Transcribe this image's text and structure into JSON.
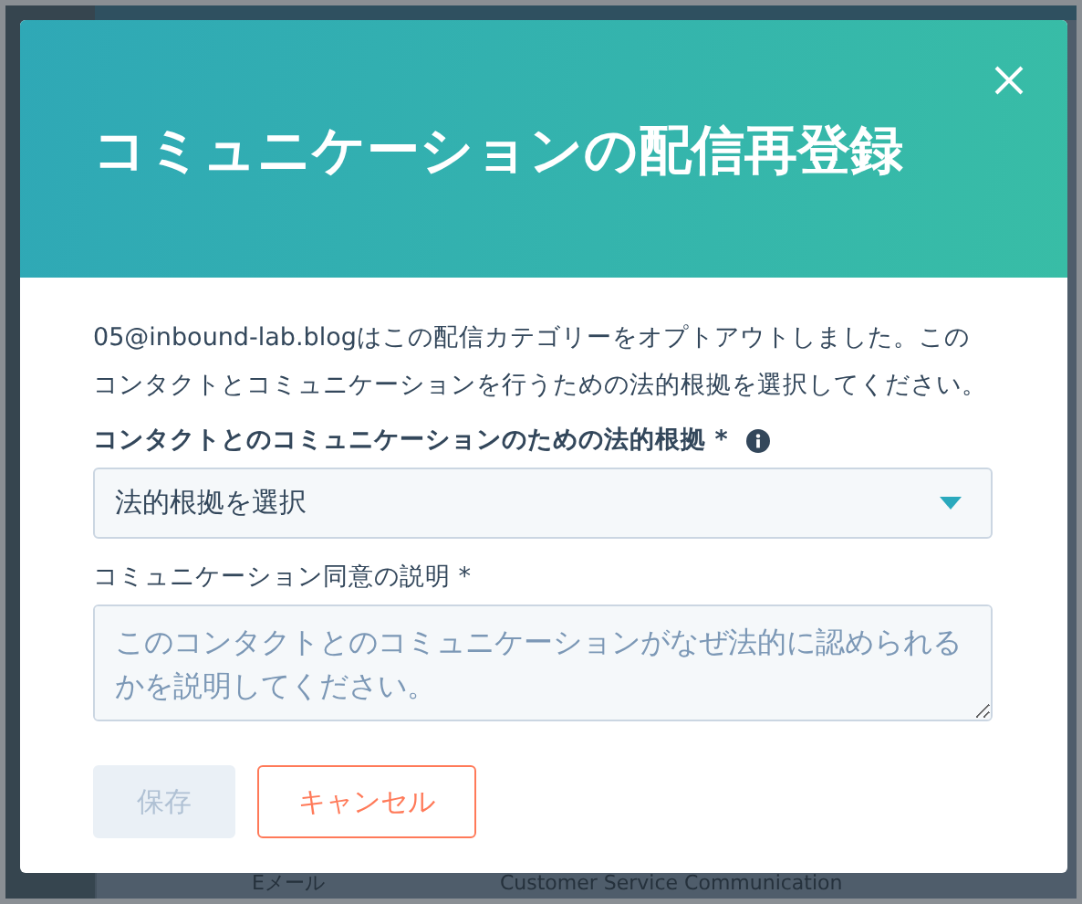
{
  "background": {
    "row": [
      "Eメール",
      "Customer Service Communication"
    ]
  },
  "dialog": {
    "title": "コミュニケーションの配信再登録",
    "message": "05@inbound-lab.blogはこの配信カテゴリーをオプトアウトしました。このコンタクトとコミュニケーションを行うための法的根拠を選択してください。",
    "basis_field": {
      "label": "コンタクトとのコミュニケーションのための法的根拠 *",
      "placeholder": "法的根拠を選択"
    },
    "explanation_field": {
      "label": "コミュニケーション同意の説明 *",
      "placeholder": "このコンタクトとのコミュニケーションがなぜ法的に認められるかを説明してください。"
    },
    "buttons": [
      {
        "label": "保存",
        "kind": "primary",
        "disabled": true
      },
      {
        "label": "キャンセル",
        "kind": "secondary",
        "disabled": false
      }
    ]
  }
}
